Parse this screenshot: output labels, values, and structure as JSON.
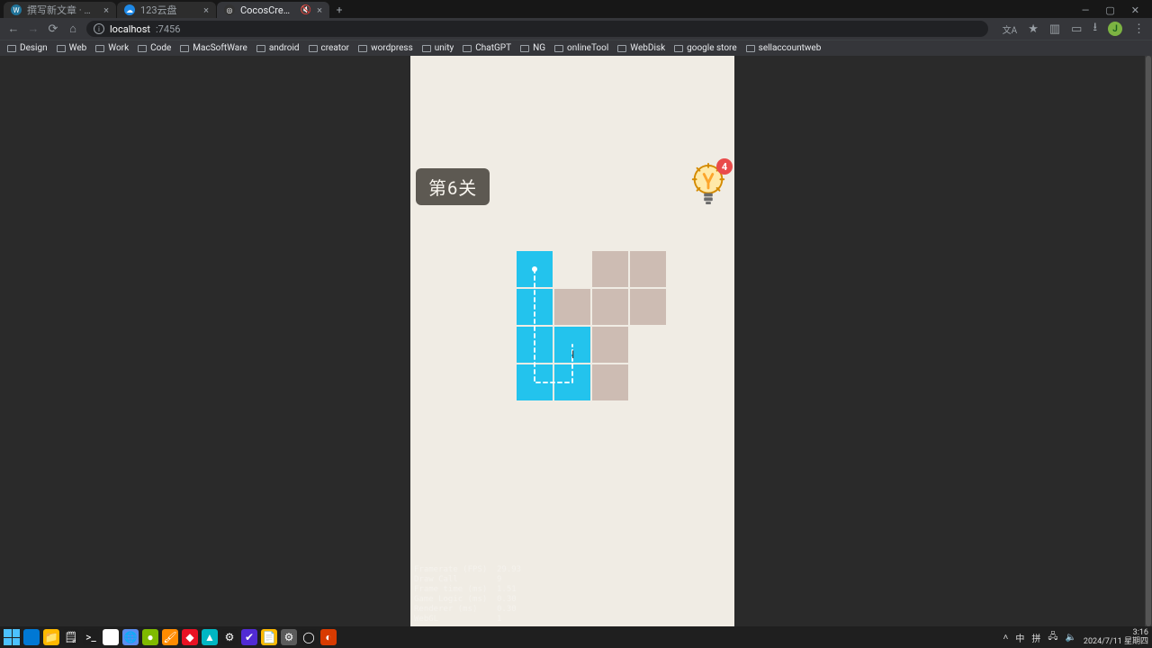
{
  "window": {
    "minimize": "—",
    "maximize": "▢",
    "close": "✕"
  },
  "tabs": [
    {
      "title": "撰写新文章 · 神管源码 — Wo…",
      "active": false,
      "muted": false
    },
    {
      "title": "123云盘",
      "active": false,
      "muted": false
    },
    {
      "title": "CocosCreator | oneLinec…",
      "active": true,
      "muted": true
    }
  ],
  "newtab": "+",
  "nav": {
    "back": "←",
    "forward": "→",
    "reload": "⟳",
    "home": "⌂"
  },
  "url": {
    "host": "localhost",
    "port": ":7456"
  },
  "toolbar_icons": {
    "translate": "文A",
    "star": "★",
    "panel": "▥",
    "reading": "▭",
    "download": "⭳",
    "menu": "⋮"
  },
  "avatar_letter": "J",
  "bookmarks": [
    "Design",
    "Web",
    "Work",
    "Code",
    "MacSoftWare",
    "android",
    "creator",
    "wordpress",
    "unity",
    "ChatGPT",
    "NG",
    "onlineTool",
    "WebDisk",
    "google store",
    "sellaccountweb"
  ],
  "game": {
    "level_label": "第6关",
    "hint_count": "4",
    "grid": [
      [
        "filled",
        "absent",
        "empty",
        "empty"
      ],
      [
        "filled",
        "empty",
        "empty",
        "empty"
      ],
      [
        "filled",
        "filled",
        "empty",
        "absent"
      ],
      [
        "filled",
        "filled",
        "empty",
        "absent"
      ]
    ],
    "path": [
      {
        "r": 0,
        "c": 0
      },
      {
        "r": 1,
        "c": 0
      },
      {
        "r": 2,
        "c": 0
      },
      {
        "r": 3,
        "c": 0
      },
      {
        "r": 3,
        "c": 1
      },
      {
        "r": 2,
        "c": 1
      }
    ],
    "cursor": "I"
  },
  "stats": [
    [
      "Framerate (FPS)",
      "29.93"
    ],
    [
      "Draw Call",
      "9"
    ],
    [
      "Frame time (ms)",
      "1.51"
    ],
    [
      "Game Logic (ms)",
      "0.30"
    ],
    [
      "Renderer (ms)",
      "0.30"
    ],
    [
      "WebGL",
      "1"
    ]
  ],
  "taskbar": {
    "icons": [
      {
        "bg": "#0078d4",
        "glyph": ""
      },
      {
        "bg": "#ffb900",
        "glyph": "📁"
      },
      {
        "bg": "#1e1e1e",
        "glyph": "🗒"
      },
      {
        "bg": "#1e1e1e",
        "glyph": ">_"
      },
      {
        "bg": "#fff",
        "glyph": "●"
      },
      {
        "bg": "#5b8def",
        "glyph": "🌐"
      },
      {
        "bg": "#7fba00",
        "glyph": "●"
      },
      {
        "bg": "#ff8c00",
        "glyph": "🖌"
      },
      {
        "bg": "#e81123",
        "glyph": "◆"
      },
      {
        "bg": "#00b7c3",
        "glyph": "▲"
      },
      {
        "bg": "#1e1e1e",
        "glyph": "⚙"
      },
      {
        "bg": "#512bd4",
        "glyph": "✔"
      },
      {
        "bg": "#ffb900",
        "glyph": "📄"
      },
      {
        "bg": "#5b5b5b",
        "glyph": "⚙"
      },
      {
        "bg": "#1e1e1e",
        "glyph": "◯"
      },
      {
        "bg": "#d83b01",
        "glyph": "◐"
      }
    ],
    "tray": {
      "chev": "˄",
      "ime1": "中",
      "ime2": "拼",
      "net": "🖧",
      "vol": "🔈",
      "time": "3:16",
      "date": "2024/7/11 星期四"
    }
  }
}
